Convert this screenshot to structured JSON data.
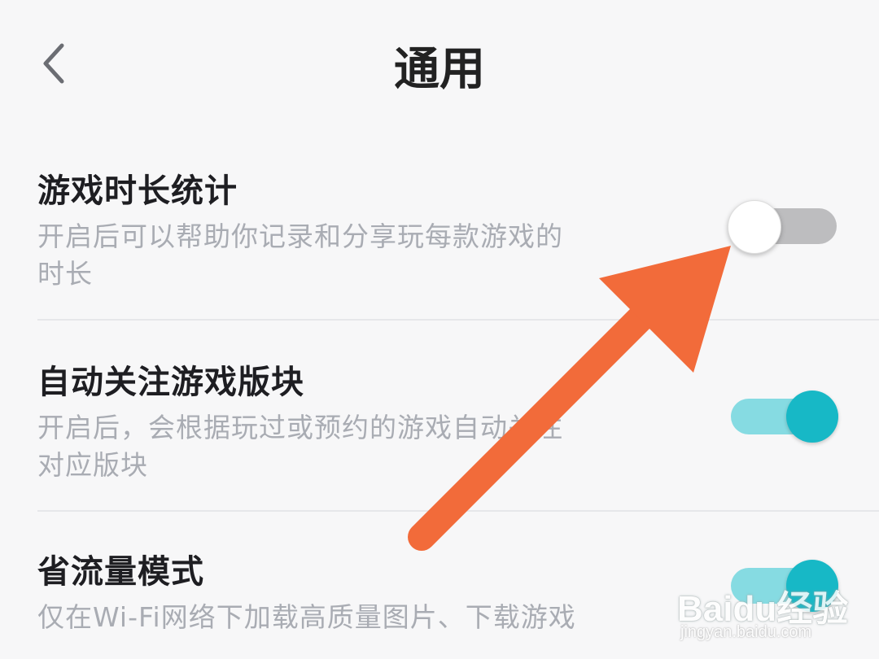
{
  "header": {
    "title": "通用",
    "back_icon": "chevron-left-icon"
  },
  "settings": [
    {
      "label": "游戏时长统计",
      "desc_line1": "开启后可以帮助你记录和分享玩每款游戏的",
      "desc_line2": "时长",
      "enabled": false
    },
    {
      "label": "自动关注游戏版块",
      "desc_line1": "开启后，会根据玩过或预约的游戏自动关注",
      "desc_line2": "对应版块",
      "enabled": true
    },
    {
      "label": "省流量模式",
      "desc_line1": "仅在Wi-Fi网络下加载高质量图片、下载游戏",
      "enabled": true
    }
  ],
  "colors": {
    "accent": "#17b8c6",
    "accent_track": "#86dbe2",
    "off_track": "#bdbdbf",
    "arrow": "#f26b3a"
  },
  "watermark": {
    "brand": "Baidu经验",
    "url": "jingyan.baidu.com"
  }
}
